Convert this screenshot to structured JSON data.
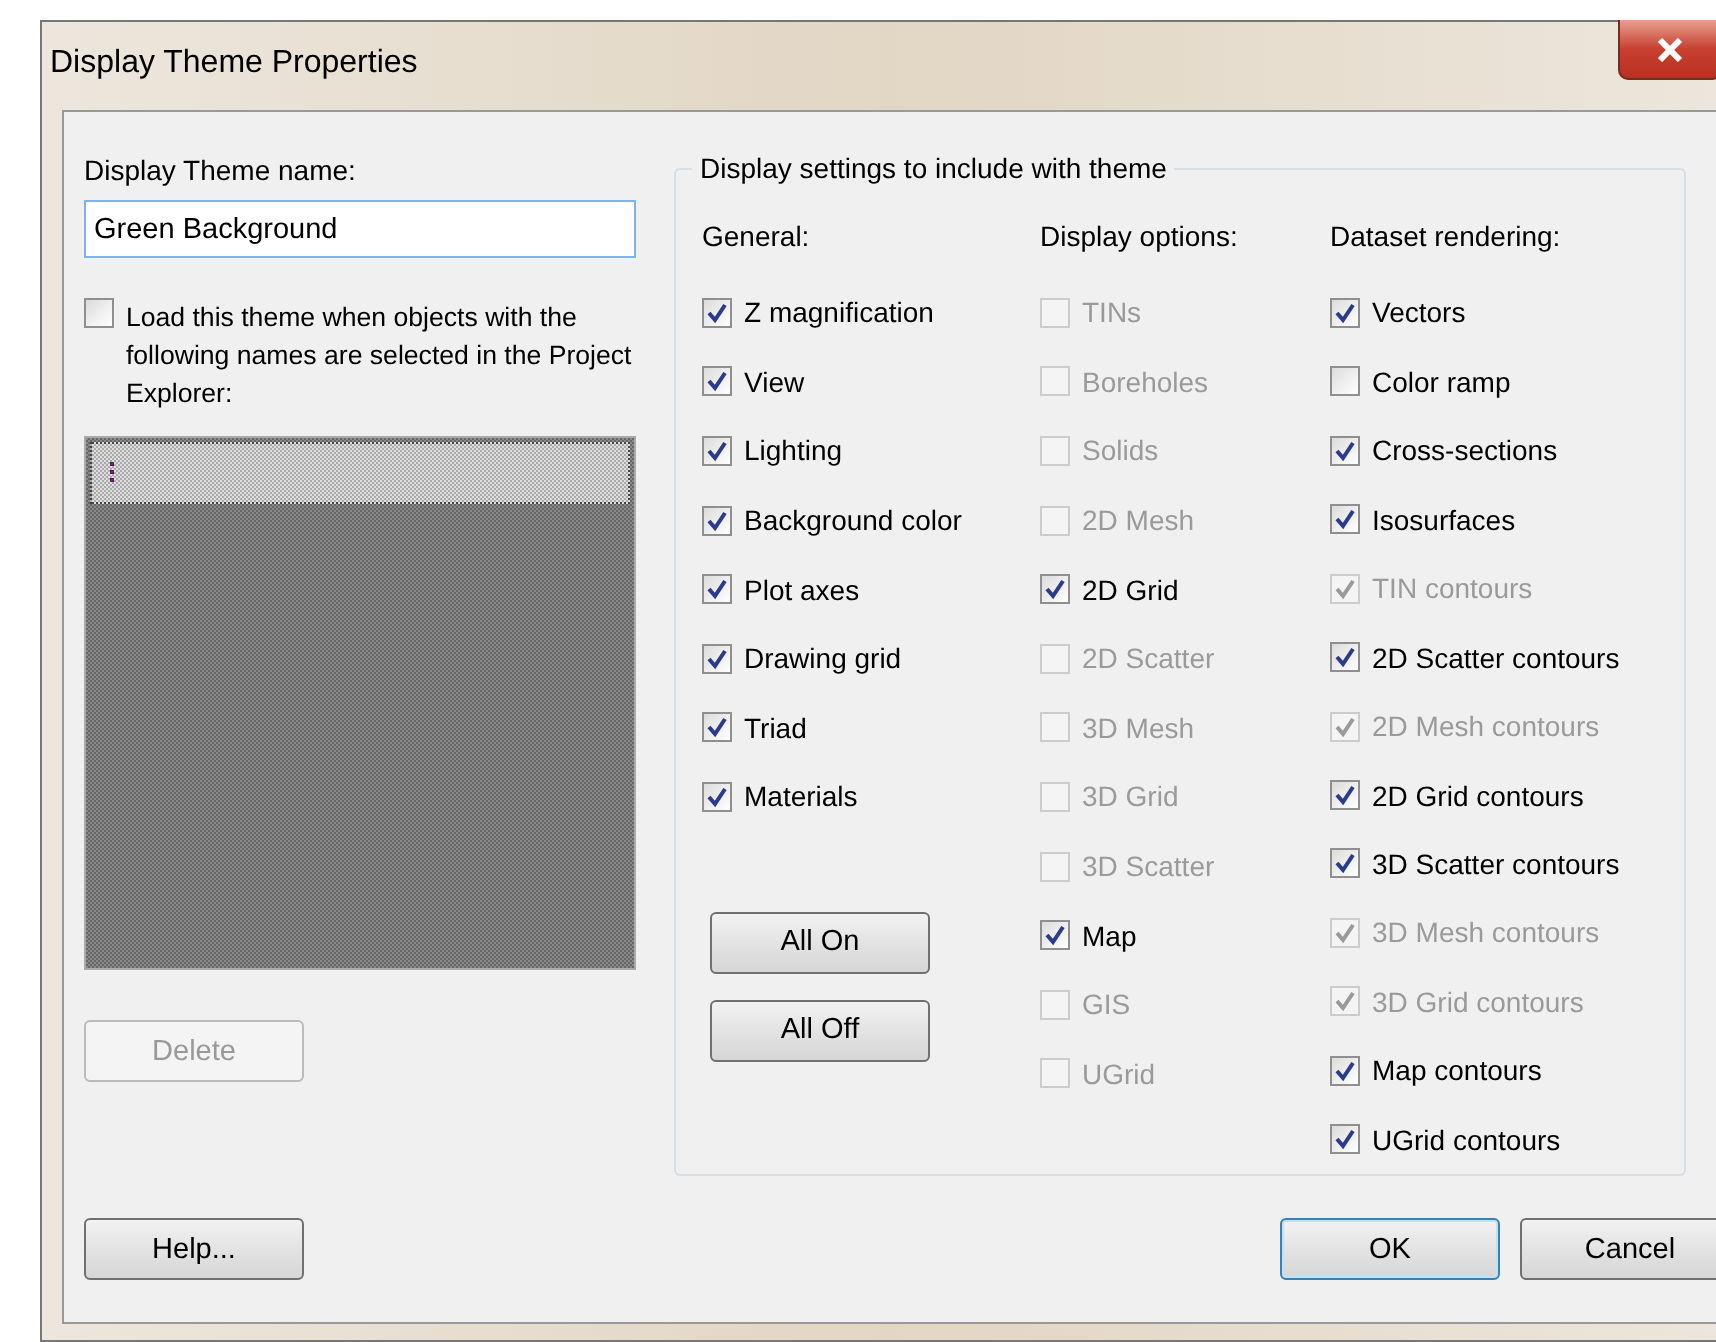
{
  "window": {
    "title": "Display Theme Properties"
  },
  "theme_name": {
    "label": "Display Theme name:",
    "value": "Green Background"
  },
  "load_option": {
    "label": "Load this theme when objects with the following names are selected in the Project Explorer:",
    "checked": false
  },
  "delete_button": {
    "label": "Delete",
    "disabled": true
  },
  "settings_group": {
    "title": "Display settings to include with theme",
    "columns": [
      {
        "heading": "General:",
        "items": [
          {
            "label": "Z magnification",
            "checked": true,
            "disabled": false
          },
          {
            "label": "View",
            "checked": true,
            "disabled": false
          },
          {
            "label": "Lighting",
            "checked": true,
            "disabled": false
          },
          {
            "label": "Background color",
            "checked": true,
            "disabled": false
          },
          {
            "label": "Plot axes",
            "checked": true,
            "disabled": false
          },
          {
            "label": "Drawing grid",
            "checked": true,
            "disabled": false
          },
          {
            "label": "Triad",
            "checked": true,
            "disabled": false
          },
          {
            "label": "Materials",
            "checked": true,
            "disabled": false
          }
        ],
        "buttons": [
          "All On",
          "All Off"
        ]
      },
      {
        "heading": "Display options:",
        "items": [
          {
            "label": "TINs",
            "checked": false,
            "disabled": true
          },
          {
            "label": "Boreholes",
            "checked": false,
            "disabled": true
          },
          {
            "label": "Solids",
            "checked": false,
            "disabled": true
          },
          {
            "label": "2D Mesh",
            "checked": false,
            "disabled": true
          },
          {
            "label": "2D Grid",
            "checked": true,
            "disabled": false
          },
          {
            "label": "2D Scatter",
            "checked": false,
            "disabled": true
          },
          {
            "label": "3D Mesh",
            "checked": false,
            "disabled": true
          },
          {
            "label": "3D Grid",
            "checked": false,
            "disabled": true
          },
          {
            "label": "3D Scatter",
            "checked": false,
            "disabled": true
          },
          {
            "label": "Map",
            "checked": true,
            "disabled": false
          },
          {
            "label": "GIS",
            "checked": false,
            "disabled": true
          },
          {
            "label": "UGrid",
            "checked": false,
            "disabled": true
          }
        ]
      },
      {
        "heading": "Dataset rendering:",
        "items": [
          {
            "label": "Vectors",
            "checked": true,
            "disabled": false
          },
          {
            "label": "Color ramp",
            "checked": false,
            "disabled": false
          },
          {
            "label": "Cross-sections",
            "checked": true,
            "disabled": false
          },
          {
            "label": "Isosurfaces",
            "checked": true,
            "disabled": false
          },
          {
            "label": "TIN contours",
            "checked": true,
            "disabled": true
          },
          {
            "label": "2D Scatter contours",
            "checked": true,
            "disabled": false
          },
          {
            "label": "2D Mesh contours",
            "checked": true,
            "disabled": true
          },
          {
            "label": "2D Grid contours",
            "checked": true,
            "disabled": false
          },
          {
            "label": "3D Scatter contours",
            "checked": true,
            "disabled": false
          },
          {
            "label": "3D Mesh contours",
            "checked": true,
            "disabled": true
          },
          {
            "label": "3D Grid contours",
            "checked": true,
            "disabled": true
          },
          {
            "label": "Map contours",
            "checked": true,
            "disabled": false
          },
          {
            "label": "UGrid contours",
            "checked": true,
            "disabled": false
          }
        ]
      }
    ]
  },
  "footer_buttons": [
    {
      "label": "Help...",
      "default": false
    },
    {
      "label": "OK",
      "default": true
    },
    {
      "label": "Cancel",
      "default": false
    }
  ]
}
